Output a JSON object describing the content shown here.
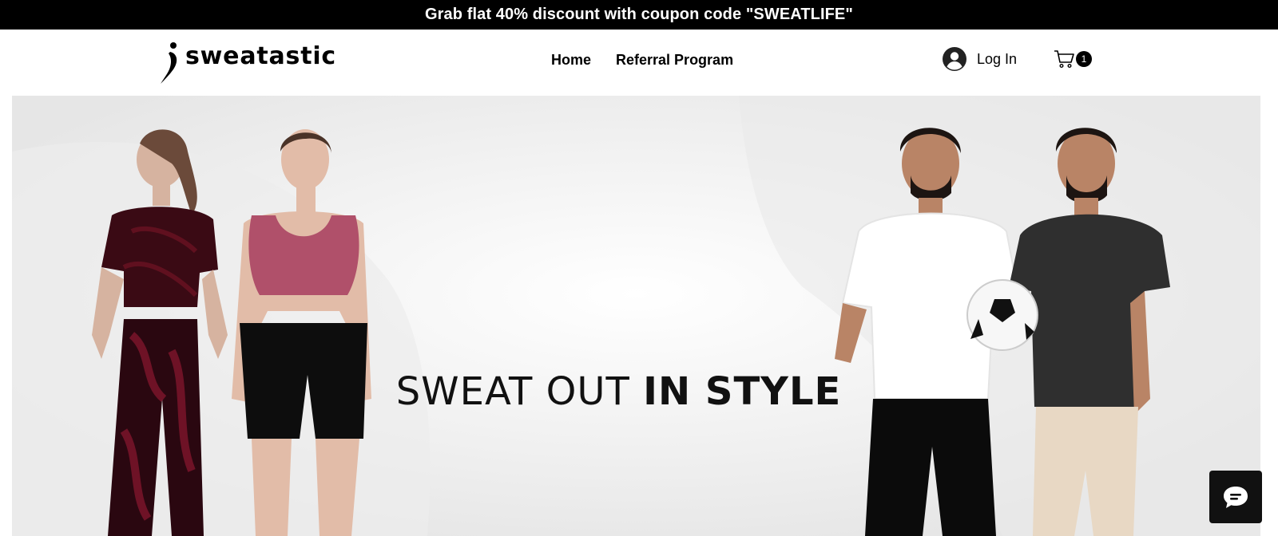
{
  "announcement": {
    "text": "Grab flat 40% discount with coupon code \"SWEATLIFE\""
  },
  "header": {
    "logo_text": "sweatastic",
    "nav": [
      {
        "label": "Home"
      },
      {
        "label": "Referral Program"
      }
    ],
    "login_label": "Log In",
    "cart_count": "1"
  },
  "hero": {
    "title_light": "SWEAT OUT ",
    "title_bold": "IN STYLE"
  },
  "icons": {
    "logo": "sweatastic-logo-mark",
    "avatar": "user-avatar-icon",
    "cart": "shopping-cart-icon",
    "chat": "chat-bubble-icon"
  },
  "colors": {
    "announcement_bg": "#000000",
    "announcement_text": "#ffffff",
    "text": "#000000",
    "hero_bg": "#f4f4f4",
    "chat_bg": "#111111"
  }
}
